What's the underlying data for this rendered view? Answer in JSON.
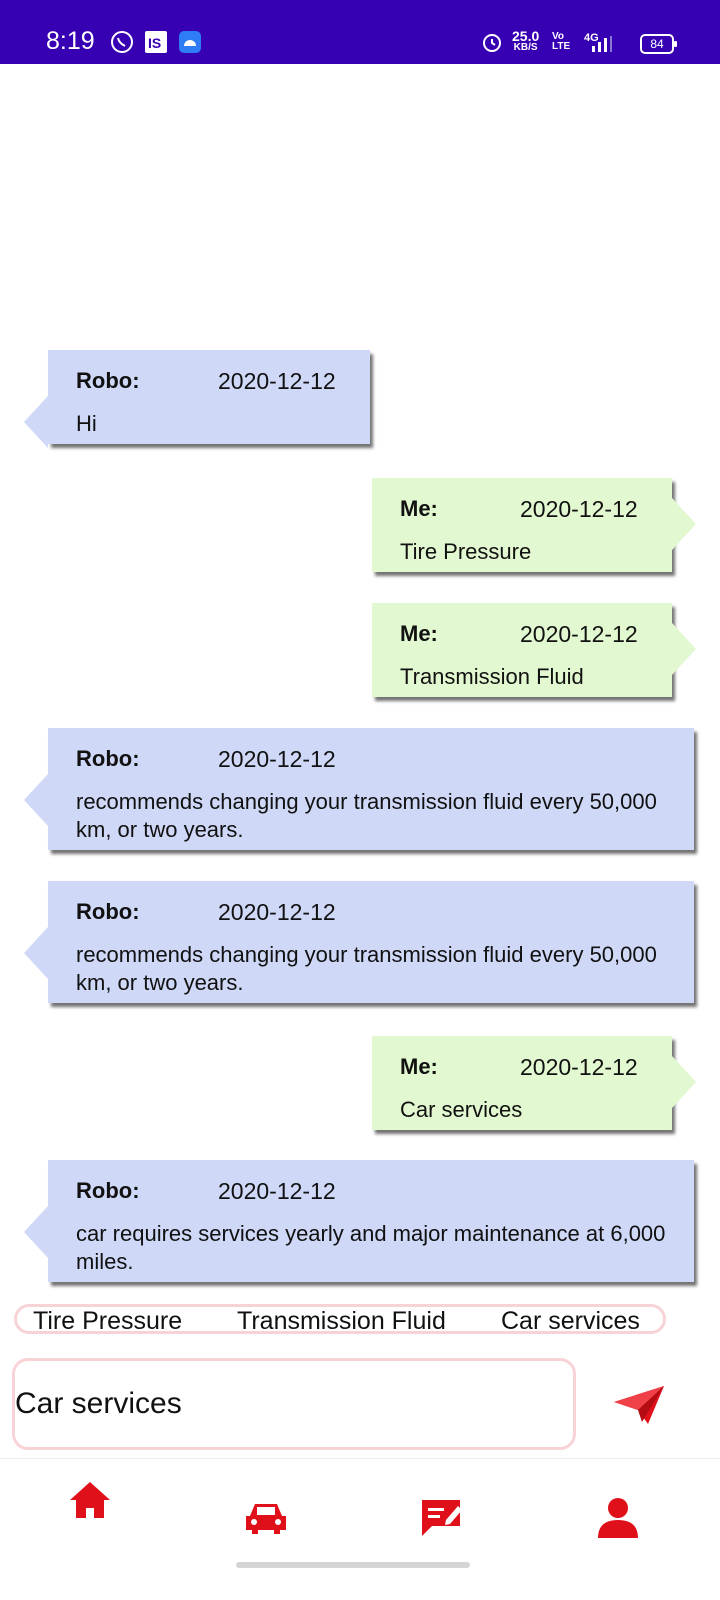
{
  "status_bar": {
    "time": "8:19",
    "net_speed": "25.0",
    "net_unit": "KB/S",
    "volte": "Vo LTE",
    "network": "4G",
    "battery": "84"
  },
  "messages": [
    {
      "sender": "Robo:",
      "date": "2020-12-12",
      "text": "Hi",
      "side": "robo"
    },
    {
      "sender": "Me:",
      "date": "2020-12-12",
      "text": "Tire Pressure",
      "side": "me"
    },
    {
      "sender": "Me:",
      "date": "2020-12-12",
      "text": "Transmission Fluid",
      "side": "me"
    },
    {
      "sender": "Robo:",
      "date": "2020-12-12",
      "text": "recommends changing your transmission fluid every 50,000 km, or two years.",
      "side": "robo"
    },
    {
      "sender": "Robo:",
      "date": "2020-12-12",
      "text": "recommends changing your transmission fluid every 50,000 km, or two years.",
      "side": "robo"
    },
    {
      "sender": "Me:",
      "date": "2020-12-12",
      "text": "Car services",
      "side": "me"
    },
    {
      "sender": "Robo:",
      "date": "2020-12-12",
      "text": "car requires services yearly and major maintenance at 6,000 miles.",
      "side": "robo"
    }
  ],
  "quick_replies": [
    "Tire Pressure",
    "Transmission Fluid",
    "Car services"
  ],
  "input": {
    "value": "Car services"
  },
  "colors": {
    "status_bar": "#3700b3",
    "robo_bubble": "#cfd8f7",
    "me_bubble": "#e2f8d0",
    "accent_red": "#e0101a",
    "outline_pink": "#f7d3d6"
  },
  "icons": {
    "send": "paper-plane-icon",
    "nav": [
      "home-icon",
      "car-icon",
      "chat-edit-icon",
      "profile-icon"
    ]
  }
}
